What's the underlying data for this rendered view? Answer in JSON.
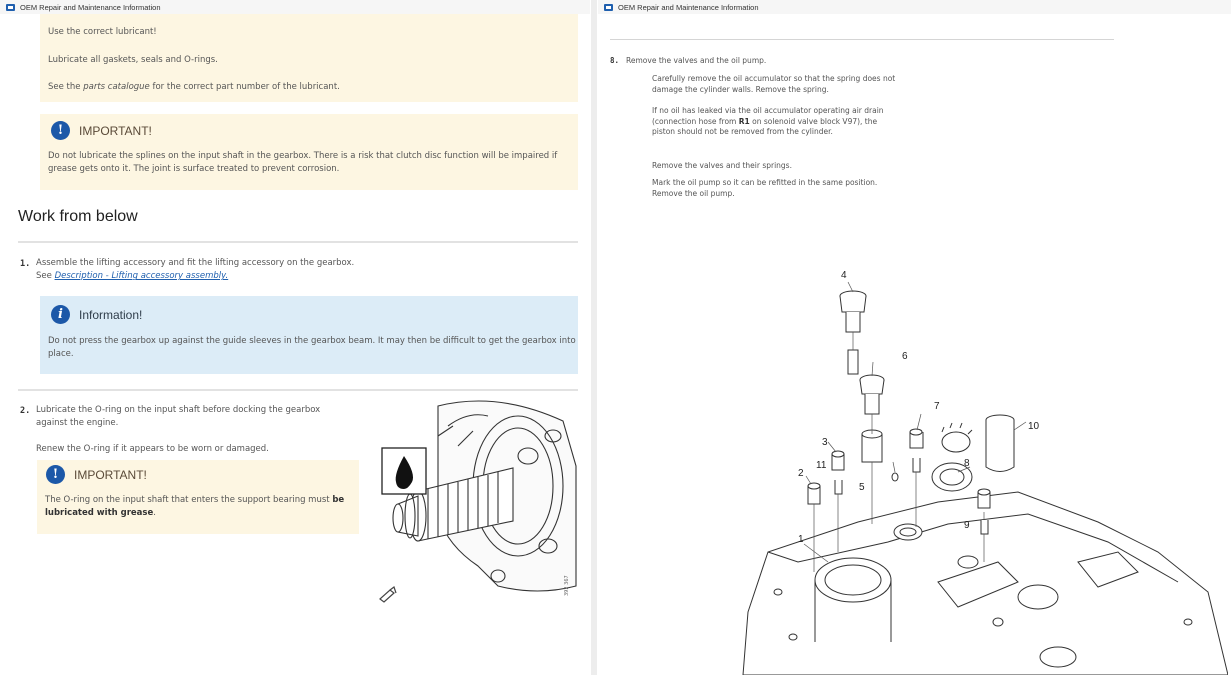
{
  "left": {
    "titlebar": "OEM Repair and Maintenance Information",
    "top_box": {
      "line1": "Use the correct lubricant!",
      "line2": "Lubricate all gaskets, seals and O-rings.",
      "line3_pre": "See the ",
      "line3_em": "parts catalogue",
      "line3_post": " for the correct part number of the lubricant."
    },
    "important1": {
      "title": "IMPORTANT!",
      "text": "Do not lubricate the splines on the input shaft in the gearbox. There is a risk that clutch disc function will be impaired if grease gets onto it. The joint is surface treated to prevent corrosion."
    },
    "section_heading": "Work from below",
    "step1": {
      "num": "1.",
      "text": "Assemble the lifting accessory and fit the lifting accessory on the gearbox. See ",
      "link": "Description - Lifting accessory assembly."
    },
    "information": {
      "title": "Information!",
      "text": "Do not press the gearbox up against the guide sleeves in the gearbox beam. It may then be difficult to get the gearbox into place."
    },
    "step2": {
      "num": "2.",
      "text1": "Lubricate the O-ring on the input shaft before docking the gearbox against the engine.",
      "text2": "Renew the O-ring if it appears to be worn or damaged."
    },
    "important2": {
      "title": "IMPORTANT!",
      "text_pre": "The O-ring on the input shaft that enters the support bearing must ",
      "text_bold": "be lubricated with grease",
      "text_post": "."
    },
    "figure_code": "392 367"
  },
  "right": {
    "titlebar": "OEM Repair and Maintenance Information",
    "step8": {
      "num": "8.",
      "title": "Remove the valves and the oil pump.",
      "p1": "Carefully remove the oil accumulator so that the spring does not damage the cylinder walls. Remove the spring.",
      "p2_pre": "If no oil has leaked via the oil accumulator operating air drain (connection hose from ",
      "p2_bold": "R1",
      "p2_post": " on solenoid valve block V97), the piston should not be removed from the cylinder.",
      "p3": "Remove the valves and their springs.",
      "p4": "Mark the oil pump so it can be refitted in the same position. Remove the oil pump."
    },
    "callouts": [
      "1",
      "2",
      "3",
      "4",
      "5",
      "6",
      "7",
      "8",
      "9",
      "10",
      "11"
    ]
  },
  "colors": {
    "important_bg": "#fdf6e2",
    "info_bg": "#dcecf7",
    "icon_blue": "#1c58a8",
    "link": "#1f5fae"
  }
}
